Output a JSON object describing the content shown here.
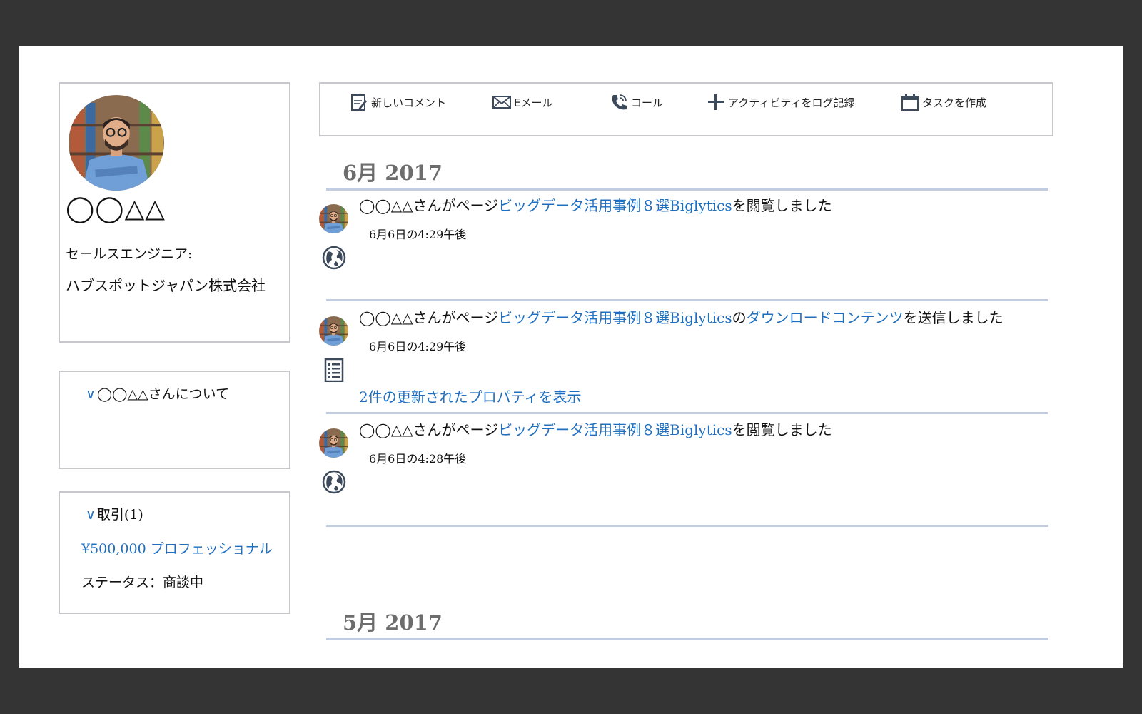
{
  "contact": {
    "name": "◯◯△△",
    "role": "セールスエンジニア:",
    "company": "ハブスポットジャパン株式会社"
  },
  "about": {
    "chevron": "∨",
    "label": "◯◯△△さんについて"
  },
  "deals": {
    "chevron": "∨",
    "label": "取引(1)",
    "deal_link": "¥500,000 プロフェッショナル",
    "status": "ステータス：商談中"
  },
  "toolbar": {
    "new_comment": "新しいコメント",
    "email": "Eメール",
    "call": "コール",
    "log_activity": "アクティビティをログ記録",
    "create_task": "タスクを作成"
  },
  "timeline": {
    "month1": "6月 2017",
    "month2": "5月 2017",
    "items": [
      {
        "prefix": "◯◯△△さんがページ",
        "page_link": "ビッグデータ活用事例８選Biglytics",
        "suffix": "を閲覧しました",
        "time": "6月6日の4:29午後",
        "icon": "globe-icon"
      },
      {
        "prefix": "◯◯△△さんがページ",
        "page_link": "ビッグデータ活用事例８選Biglytics",
        "middle": "の",
        "content_link": "ダウンロードコンテンツ",
        "suffix": "を送信しました",
        "time": "6月6日の4:29午後",
        "icon": "form-icon",
        "more": "2件の更新されたプロパティを表示"
      },
      {
        "prefix": "◯◯△△さんがページ",
        "page_link": "ビッグデータ活用事例８選Biglytics",
        "suffix": "を閲覧しました",
        "time": "6月6日の4:28午後",
        "icon": "globe-icon"
      }
    ]
  },
  "colors": {
    "link": "#1f6fc0",
    "rule": "#c3cde2",
    "border": "#c8c8cc",
    "frame": "#343434"
  }
}
